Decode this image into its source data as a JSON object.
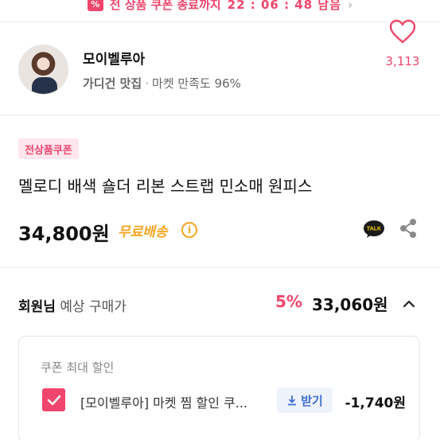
{
  "banner": {
    "icon": "coupon-ticket-icon",
    "icon_glyph": "%",
    "text": "전 상품 쿠폰 종료까지",
    "time": "22 : 06 : 48 남음"
  },
  "store": {
    "name": "모이벨루아",
    "category": "가디건 맛집",
    "satisfaction": "마켓 만족도 96%",
    "likes": "3,113"
  },
  "product": {
    "coupon_chip": "전상품쿠폰",
    "title": "멜로디 배색 숄더 리본 스트랩 민소매 원피스",
    "price": "34,800원",
    "shipping": "무료배송",
    "info_glyph": "i",
    "talk_label": "TALK"
  },
  "member": {
    "label_strong": "회원님",
    "label_rest": "예상 구매가",
    "rate": "5%",
    "price": "33,060원"
  },
  "coupon": {
    "header": "쿠폰 최대 할인",
    "name": "[모이벨루아] 마켓 찜 할인 쿠...",
    "download": "받기",
    "discount": "-1,740원"
  },
  "colors": {
    "accent": "#f0456c",
    "free_shipping": "#f5a623",
    "download": "#3f6fcf"
  }
}
